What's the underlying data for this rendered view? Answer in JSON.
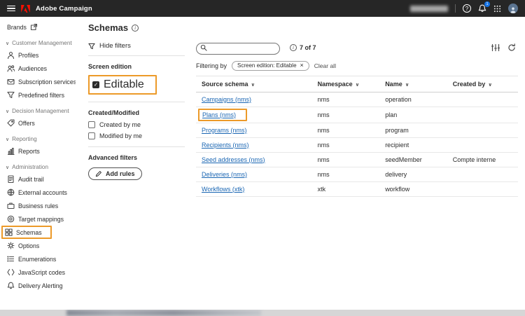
{
  "colors": {
    "topbar_bg": "#262626",
    "adobe_red": "#FA0F00",
    "accent_blue": "#1473E6",
    "link_blue": "#1a66b3",
    "annotation_orange": "#EC9A29"
  },
  "header": {
    "app_name": "Adobe Campaign",
    "notification_badge": "1"
  },
  "sidebar": {
    "brands_label": "Brands",
    "sections": [
      {
        "label": "Customer Management",
        "items": [
          "Profiles",
          "Audiences",
          "Subscription services",
          "Predefined filters"
        ]
      },
      {
        "label": "Decision Management",
        "items": [
          "Offers"
        ]
      },
      {
        "label": "Reporting",
        "items": [
          "Reports"
        ]
      },
      {
        "label": "Administration",
        "items": [
          "Audit trail",
          "External accounts",
          "Business rules",
          "Target mappings",
          "Schemas",
          "Options",
          "Enumerations",
          "JavaScript codes",
          "Delivery Alerting"
        ]
      }
    ]
  },
  "page": {
    "title": "Schemas"
  },
  "filters": {
    "hide_filters_label": "Hide filters",
    "groups": [
      {
        "title": "Screen edition",
        "options": [
          {
            "label": "Editable",
            "checked": true
          }
        ]
      },
      {
        "title": "Created/Modified",
        "options": [
          {
            "label": "Created by me",
            "checked": false
          },
          {
            "label": "Modified by me",
            "checked": false
          }
        ]
      }
    ],
    "advanced_title": "Advanced filters",
    "add_rules_label": "Add rules"
  },
  "toolbar": {
    "search_placeholder": "",
    "count_text": "7 of 7"
  },
  "filtering": {
    "label": "Filtering by",
    "chip": "Screen edition: Editable",
    "clear_all": "Clear all"
  },
  "table": {
    "columns": [
      "Source schema",
      "Namespace",
      "Name",
      "Created by"
    ],
    "rows": [
      {
        "schema": "Campaigns (nms)",
        "namespace": "nms",
        "name": "operation",
        "created_by": ""
      },
      {
        "schema": "Plans (nms)",
        "namespace": "nms",
        "name": "plan",
        "created_by": ""
      },
      {
        "schema": "Programs (nms)",
        "namespace": "nms",
        "name": "program",
        "created_by": ""
      },
      {
        "schema": "Recipients (nms)",
        "namespace": "nms",
        "name": "recipient",
        "created_by": ""
      },
      {
        "schema": "Seed addresses (nms)",
        "namespace": "nms",
        "name": "seedMember",
        "created_by": "Compte interne"
      },
      {
        "schema": "Deliveries (nms)",
        "namespace": "nms",
        "name": "delivery",
        "created_by": ""
      },
      {
        "schema": "Workflows (xtk)",
        "namespace": "xtk",
        "name": "workflow",
        "created_by": ""
      }
    ]
  }
}
